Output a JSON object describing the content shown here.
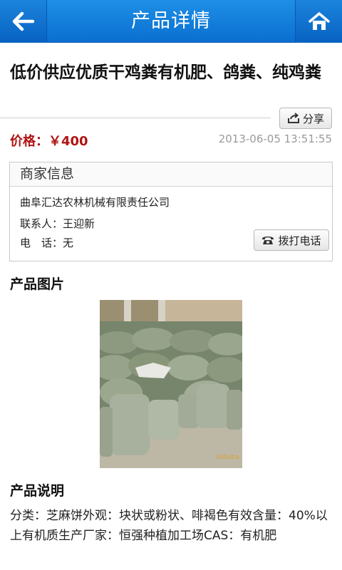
{
  "header": {
    "title": "产品详情",
    "back_icon": "arrow-left-icon",
    "home_icon": "home-icon"
  },
  "product": {
    "title": "低价供应优质干鸡粪有机肥、鸽粪、纯鸡粪",
    "share_label": "分享",
    "price_label": "价格：",
    "price_value": "￥400",
    "date": "2013-06-05 13:51:55"
  },
  "merchant": {
    "heading": "商家信息",
    "company": "曲阜汇达农林机械有限责任公司",
    "contact_label": "联系人：",
    "contact_name": "王迎新",
    "phone_label": "电　话：",
    "phone_value": "无",
    "call_label": "拨打电话"
  },
  "images_section": {
    "title": "产品图片",
    "watermark": "alibaba"
  },
  "description_section": {
    "title": "产品说明",
    "text": "分类：芝麻饼外观：块状或粉状、啡褐色有效含量：40%以上有机质生产厂家：恒强种植加工场CAS：有机肥"
  },
  "colors": {
    "header_blue": "#0a6fd0",
    "price_red": "#b01414"
  }
}
